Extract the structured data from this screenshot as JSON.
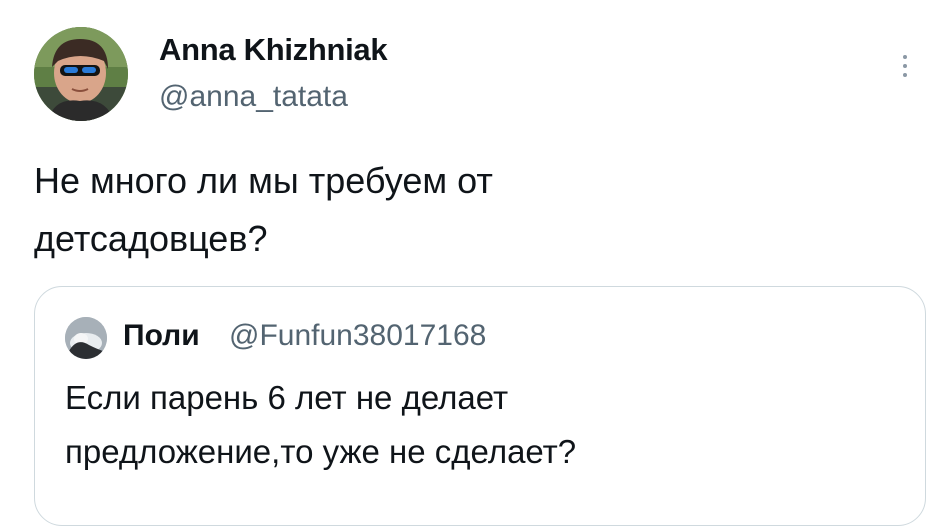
{
  "tweet": {
    "author_name": "Anna Khizhniak",
    "author_handle": "@anna_tatata",
    "text": "Не много ли мы требуем от\nдетсадовцев?",
    "more_icon": "more-vertical-icon"
  },
  "quote": {
    "author_name": "Поли",
    "author_handle": "@Funfun38017168",
    "text": "Если парень 6 лет не делает\nпредложение,то уже не сделает?"
  },
  "colors": {
    "text_primary": "#0f1419",
    "text_secondary": "#536471",
    "border": "#cfd9de"
  }
}
